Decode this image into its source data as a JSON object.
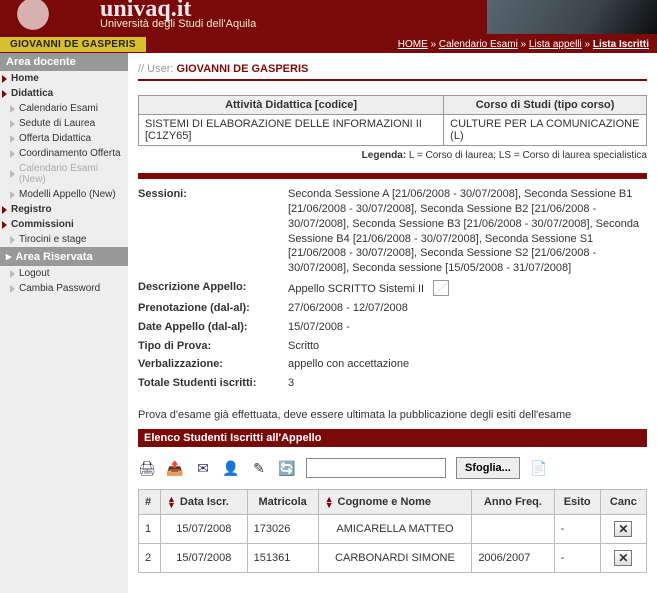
{
  "banner": {
    "title": "univaq.it",
    "subtitle": "Università degli Studi dell'Aquila",
    "username_badge": "GIOVANNI DE GASPERIS"
  },
  "breadcrumb": {
    "home": "HOME",
    "sep": " » ",
    "cal": "Calendario Esami",
    "lista": "Lista appelli",
    "current": "Lista Iscritti"
  },
  "sidebar": {
    "area_docente": "Area docente",
    "home": "Home",
    "didattica": "Didattica",
    "calendario": "Calendario Esami",
    "sedute": "Sedute di Laurea",
    "offerta": "Offerta Didattica",
    "coord": "Coordinamento Offerta",
    "calnew": "Calendario Esami (New)",
    "modelli": "Modelli Appello (New)",
    "registro": "Registro",
    "commissioni": "Commissioni",
    "tirocini": "Tirocini e stage",
    "area_riservata": "Area Riservata",
    "logout": "Logout",
    "cambia": "Cambia Password"
  },
  "user_line": {
    "prefix": "// User: ",
    "name": "GIOVANNI DE GASPERIS"
  },
  "info_table": {
    "h1": "Attività Didattica [codice]",
    "h2": "Corso di Studi (tipo corso)",
    "c1": "SISTEMI DI ELABORAZIONE DELLE INFORMAZIONI II [C1ZY65]",
    "c2": "CULTURE PER LA COMUNICAZIONE (L)"
  },
  "legenda": {
    "label": "Legenda:",
    "text": " L = Corso di laurea; LS = Corso di laurea specialistica"
  },
  "details": {
    "sessioni_label": "Sessioni:",
    "sessioni_val": "Seconda Sessione A [21/06/2008 - 30/07/2008], Seconda Sessione B1 [21/06/2008 - 30/07/2008], Seconda Sessione B2 [21/06/2008 - 30/07/2008], Seconda Sessione B3 [21/06/2008 - 30/07/2008], Seconda Sessione B4 [21/06/2008 - 30/07/2008], Seconda Sessione S1 [21/06/2008 - 30/07/2008], Seconda Sessione S2 [21/06/2008 - 30/07/2008], Seconda sessione [15/05/2008 - 31/07/2008]",
    "desc_label": "Descrizione Appello:",
    "desc_val": "Appello SCRITTO Sistemi II",
    "pren_label": "Prenotazione (dal-al):",
    "pren_val": "27/06/2008 - 12/07/2008",
    "date_label": "Date Appello (dal-al):",
    "date_val": "15/07/2008 -",
    "tipo_label": "Tipo di Prova:",
    "tipo_val": "Scritto",
    "verb_label": "Verbalizzazione:",
    "verb_val": "appello con accettazione",
    "tot_label": "Totale Studenti iscritti:",
    "tot_val": "3"
  },
  "notice": "Prova d'esame già effettuata, deve essere ultimata la pubblicazione degli esiti dell'esame",
  "redbar": "Elenco Studenti Iscritti all'Appello",
  "file_btn": "Sfoglia...",
  "list": {
    "h_num": "#",
    "h_data": "Data Iscr.",
    "h_matricola": "Matricola",
    "h_nome": "Cognome e Nome",
    "h_anno": "Anno Freq.",
    "h_esito": "Esito",
    "h_canc": "Canc",
    "rows": [
      {
        "n": "1",
        "data": "15/07/2008",
        "matr": "173026",
        "nome": "AMICARELLA MATTEO",
        "anno": "",
        "esito": "-"
      },
      {
        "n": "2",
        "data": "15/07/2008",
        "matr": "151361",
        "nome": "CARBONARDI SIMONE",
        "anno": "2006/2007",
        "esito": "-"
      }
    ]
  }
}
